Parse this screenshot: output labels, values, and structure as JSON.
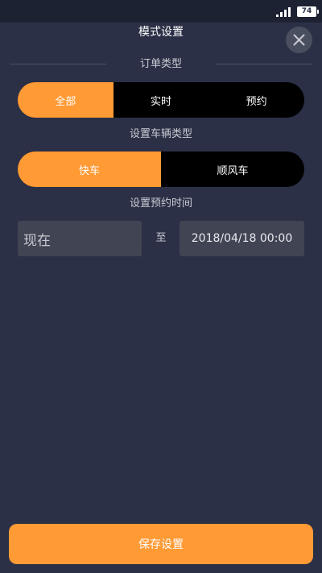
{
  "status_bar": {
    "signal_icon": "signal-bars-icon",
    "battery_level": "74"
  },
  "header": {
    "title": "模式设置",
    "close_icon": "close-icon"
  },
  "order_type": {
    "label": "订单类型",
    "options": [
      "全部",
      "实时",
      "预约"
    ],
    "selected": "全部"
  },
  "vehicle_type": {
    "label": "设置车辆类型",
    "options": [
      "快车",
      "顺风车"
    ],
    "selected": "快车"
  },
  "reservation_time": {
    "label": "设置预约时间",
    "start": "现在",
    "separator": "至",
    "end": "2018/04/18 00:00"
  },
  "footer": {
    "save_label": "保存设置"
  },
  "colors": {
    "background": "#2b3046",
    "accent": "#ff9a35",
    "segment_inactive": "#000000",
    "input_background": "#414453"
  }
}
